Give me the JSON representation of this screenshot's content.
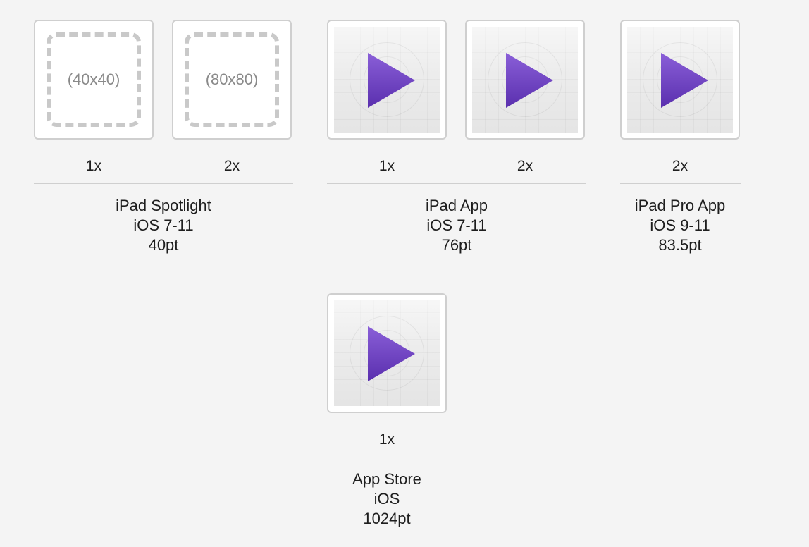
{
  "groups": [
    {
      "name": "iPad Spotlight",
      "os": "iOS 7-11",
      "size": "40pt",
      "slots": [
        {
          "scale": "1x",
          "filled": false,
          "placeholder": "(40x40)"
        },
        {
          "scale": "2x",
          "filled": false,
          "placeholder": "(80x80)"
        }
      ]
    },
    {
      "name": "iPad App",
      "os": "iOS 7-11",
      "size": "76pt",
      "slots": [
        {
          "scale": "1x",
          "filled": true,
          "icon": "play-app-icon"
        },
        {
          "scale": "2x",
          "filled": true,
          "icon": "play-app-icon"
        }
      ]
    },
    {
      "name": "iPad Pro App",
      "os": "iOS 9-11",
      "size": "83.5pt",
      "slots": [
        {
          "scale": "2x",
          "filled": true,
          "icon": "play-app-icon"
        }
      ]
    },
    {
      "name": "App Store",
      "os": "iOS",
      "size": "1024pt",
      "slots": [
        {
          "scale": "1x",
          "filled": true,
          "icon": "play-app-icon"
        }
      ]
    }
  ],
  "colors": {
    "background": "#f4f4f4",
    "play_triangle": "#6a3fbf",
    "slot_border": "#cfcfcf"
  }
}
